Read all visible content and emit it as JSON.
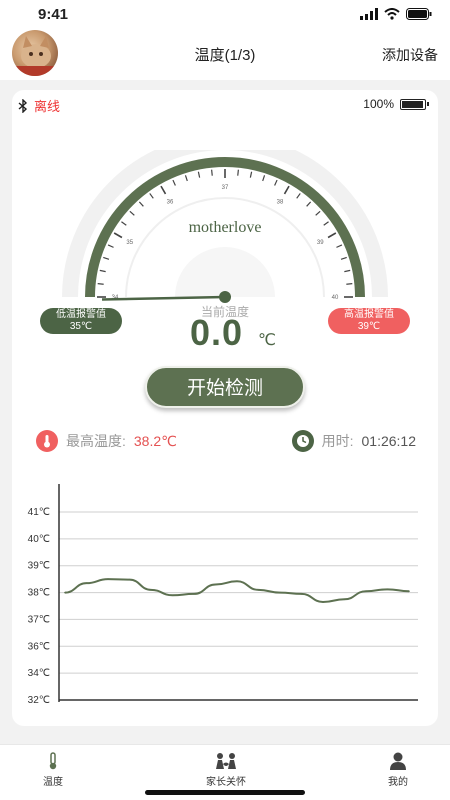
{
  "status_bar": {
    "time": "9:41"
  },
  "header": {
    "title": "温度(1/3)",
    "add_device": "添加设备"
  },
  "device": {
    "connection": "离线",
    "battery": "100%",
    "battery_level": 1.0,
    "brand": "motherlove"
  },
  "gauge": {
    "min": 34,
    "max": 40,
    "ticks": [
      "34",
      "35",
      "36",
      "37",
      "38",
      "39",
      "40"
    ],
    "needle_value": 34
  },
  "alarms": {
    "low_label": "低温报警值",
    "low_value": "35℃",
    "high_label": "高温报警值",
    "high_value": "39℃"
  },
  "current": {
    "label": "当前温度",
    "value": "0.0",
    "unit": "℃"
  },
  "start_button": "开始检测",
  "stats": {
    "max_label": "最高温度: ",
    "max_value": "38.2℃",
    "time_label": "用时: ",
    "time_value": "01:26:12"
  },
  "chart_data": {
    "type": "line",
    "y_ticks": [
      "41℃",
      "40℃",
      "39℃",
      "38℃",
      "37℃",
      "36℃",
      "34℃",
      "32℃"
    ],
    "values": [
      38.0,
      38.35,
      38.5,
      38.48,
      38.1,
      37.9,
      37.95,
      38.3,
      38.42,
      38.1,
      38.0,
      37.95,
      37.65,
      37.75,
      38.05,
      38.12,
      38.05
    ],
    "grid": true
  },
  "tabs": [
    {
      "label": "温度",
      "icon": "thermometer-icon"
    },
    {
      "label": "家长关怀",
      "icon": "parent-care-icon"
    },
    {
      "label": "我的",
      "icon": "user-icon"
    }
  ],
  "colors": {
    "accent": "#4c6445",
    "alert": "#f06060",
    "max_temp": "#e45252"
  }
}
